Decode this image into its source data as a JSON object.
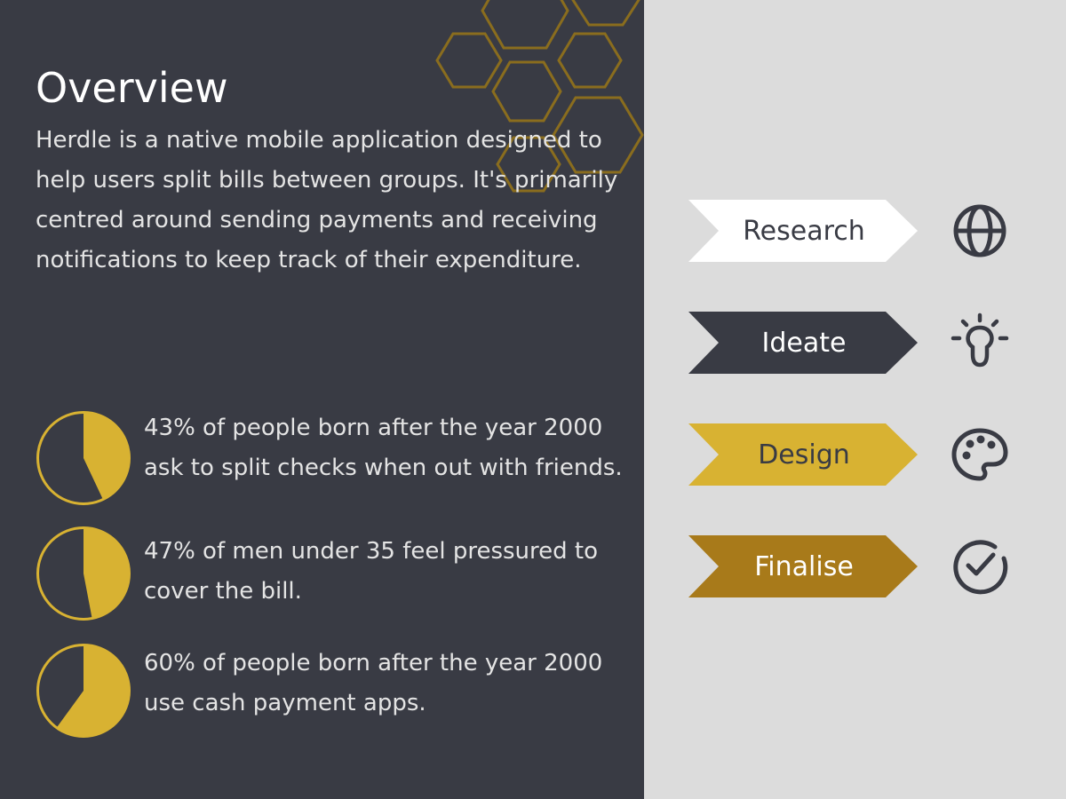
{
  "colors": {
    "panel_dark": "#393b44",
    "panel_light": "#dcdcdc",
    "gold": "#d8b232",
    "gold_dark": "#a87a1a",
    "hex_outline": "#8a6d1e"
  },
  "overview": {
    "title": "Overview",
    "description": "Herdle is a native mobile application designed to help users split bills between groups. It's primarily centred around sending payments and receiving notifications to keep track of their expenditure."
  },
  "stats": [
    {
      "percent": 43,
      "text": "43% of people born after the year 2000 ask to split checks when out with friends."
    },
    {
      "percent": 47,
      "text": "47% of men under 35 feel pressured to cover the bill."
    },
    {
      "percent": 60,
      "text": "60% of people born after the year 2000 use cash payment apps."
    }
  ],
  "process": [
    {
      "label": "Research",
      "icon": "globe-icon",
      "fill": "#ffffff",
      "text_color": "#393b44"
    },
    {
      "label": "Ideate",
      "icon": "lightbulb-icon",
      "fill": "#393b44",
      "text_color": "#ffffff"
    },
    {
      "label": "Design",
      "icon": "palette-icon",
      "fill": "#d8b232",
      "text_color": "#393b44"
    },
    {
      "label": "Finalise",
      "icon": "check-circle-icon",
      "fill": "#a87a1a",
      "text_color": "#ffffff"
    }
  ]
}
